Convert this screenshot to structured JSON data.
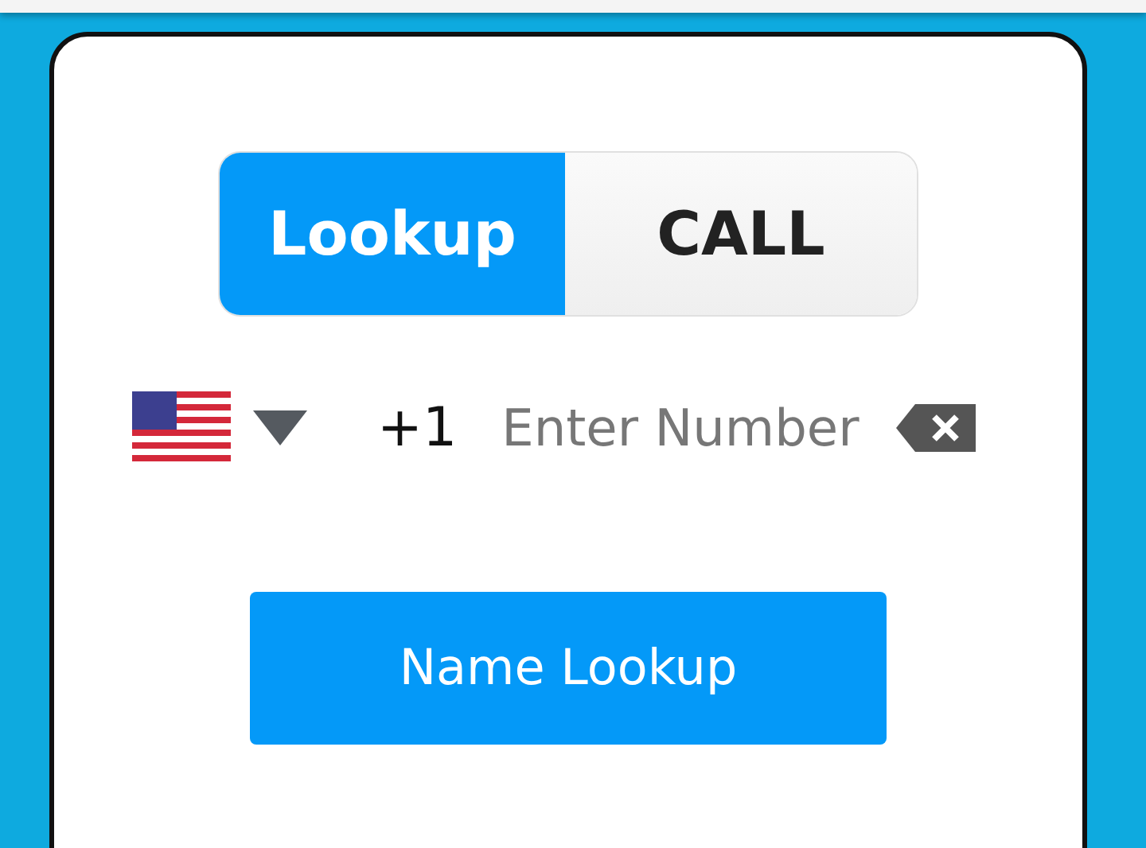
{
  "tabs": [
    {
      "label": "Lookup",
      "selected": true
    },
    {
      "label": "CALL",
      "selected": false
    }
  ],
  "phone": {
    "country_code": "+1",
    "placeholder": "Enter Number"
  },
  "lookup_button": "Name Lookup"
}
